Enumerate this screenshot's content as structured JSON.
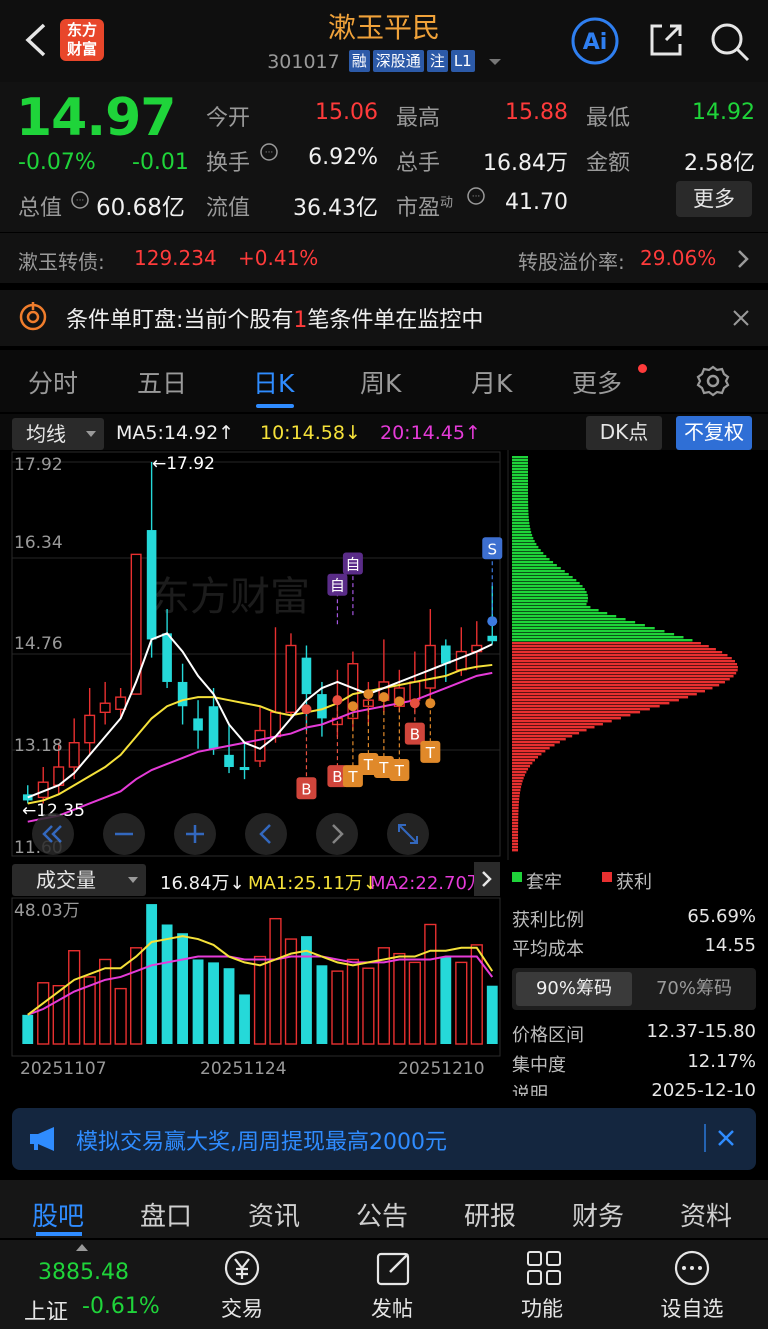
{
  "header": {
    "title": "漱玉平民",
    "code": "301017",
    "tags": [
      "融",
      "深股通",
      "注",
      "L1"
    ],
    "logo_line1": "东方",
    "logo_line2": "财富",
    "ai_label": "Ai"
  },
  "quote": {
    "price": "14.97",
    "change_pct": "-0.07%",
    "change_amt": "-0.01",
    "total_value_label": "总值",
    "total_value": "60.68亿",
    "fields": [
      {
        "label": "今开",
        "value": "15.06",
        "color": "#ff3b3b"
      },
      {
        "label": "最高",
        "value": "15.88",
        "color": "#ff3b3b"
      },
      {
        "label": "最低",
        "value": "14.92",
        "color": "#1fd43a"
      },
      {
        "label": "换手",
        "value": "6.92%",
        "color": "#f0f0f0"
      },
      {
        "label": "总手",
        "value": "16.84万",
        "color": "#f0f0f0"
      },
      {
        "label": "金额",
        "value": "2.58亿",
        "color": "#f0f0f0"
      },
      {
        "label": "流值",
        "value": "36.43亿",
        "color": "#f0f0f0"
      },
      {
        "label": "市盈",
        "value": "41.70",
        "color": "#f0f0f0"
      }
    ],
    "pe_superscript": "动",
    "more_button": "更多"
  },
  "bond": {
    "name": "漱玉转债:",
    "price": "129.234",
    "change": "+0.41%",
    "premium_label": "转股溢价率:",
    "premium_value": "29.06%"
  },
  "condition": {
    "prefix": "条件单盯盘:当前个股有",
    "count": "1",
    "suffix": "笔条件单在监控中"
  },
  "tabs": [
    "分时",
    "五日",
    "日K",
    "周K",
    "月K",
    "更多"
  ],
  "active_tab": "日K",
  "chart_toolbar": {
    "ma_select": "均线",
    "ma5": "MA5:14.92↑",
    "ma10": "10:14.58↓",
    "ma20": "20:14.45↑",
    "dk_button": "DK点",
    "adjust_button": "不复权"
  },
  "volume_toolbar": {
    "select": "成交量",
    "volume": "16.84万↓",
    "ma1": "MA1:25.11万↓",
    "ma2": "MA2:22.70万"
  },
  "axis": {
    "price_ticks": [
      "17.92",
      "16.34",
      "14.76",
      "13.18",
      "11.60"
    ],
    "volume_max": "48.03万",
    "dates": [
      "20251107",
      "20251124",
      "20251210"
    ],
    "high_marker": "←17.92",
    "low_marker": "←12.35",
    "watermark": "东方财富"
  },
  "chart_data": {
    "type": "candlestick",
    "ylim": [
      11.6,
      17.92
    ],
    "candles": [
      {
        "o": 12.45,
        "c": 12.35,
        "h": 12.6,
        "l": 12.3,
        "v": 10
      },
      {
        "o": 12.4,
        "c": 12.65,
        "h": 12.9,
        "l": 12.3,
        "v": 21
      },
      {
        "o": 12.6,
        "c": 12.9,
        "h": 13.3,
        "l": 12.45,
        "v": 20
      },
      {
        "o": 12.9,
        "c": 13.3,
        "h": 13.7,
        "l": 12.7,
        "v": 32
      },
      {
        "o": 13.3,
        "c": 13.75,
        "h": 14.2,
        "l": 13.1,
        "v": 23
      },
      {
        "o": 13.8,
        "c": 13.95,
        "h": 14.3,
        "l": 13.6,
        "v": 29
      },
      {
        "o": 13.85,
        "c": 14.05,
        "h": 14.2,
        "l": 13.7,
        "v": 19
      },
      {
        "o": 14.1,
        "c": 16.4,
        "h": 16.4,
        "l": 14.1,
        "v": 33
      },
      {
        "o": 16.8,
        "c": 15.0,
        "h": 17.92,
        "l": 14.7,
        "v": 48
      },
      {
        "o": 15.1,
        "c": 14.3,
        "h": 15.5,
        "l": 14.2,
        "v": 41
      },
      {
        "o": 14.3,
        "c": 13.9,
        "h": 14.6,
        "l": 13.6,
        "v": 38
      },
      {
        "o": 13.7,
        "c": 13.5,
        "h": 14.0,
        "l": 13.2,
        "v": 29
      },
      {
        "o": 13.9,
        "c": 13.2,
        "h": 14.2,
        "l": 13.1,
        "v": 28
      },
      {
        "o": 13.1,
        "c": 12.9,
        "h": 13.6,
        "l": 12.8,
        "v": 26
      },
      {
        "o": 12.9,
        "c": 12.85,
        "h": 13.3,
        "l": 12.7,
        "v": 17
      },
      {
        "o": 13.0,
        "c": 13.5,
        "h": 13.9,
        "l": 12.9,
        "v": 30
      },
      {
        "o": 13.4,
        "c": 13.8,
        "h": 15.2,
        "l": 13.3,
        "v": 43
      },
      {
        "o": 13.8,
        "c": 14.9,
        "h": 15.1,
        "l": 13.7,
        "v": 36
      },
      {
        "o": 14.7,
        "c": 14.1,
        "h": 14.9,
        "l": 13.5,
        "v": 37
      },
      {
        "o": 14.1,
        "c": 13.7,
        "h": 14.3,
        "l": 13.4,
        "v": 27
      },
      {
        "o": 13.6,
        "c": 13.7,
        "h": 14.5,
        "l": 13.4,
        "v": 25
      },
      {
        "o": 13.7,
        "c": 14.6,
        "h": 14.8,
        "l": 13.5,
        "v": 29
      },
      {
        "o": 13.9,
        "c": 14.0,
        "h": 14.3,
        "l": 13.6,
        "v": 26
      },
      {
        "o": 14.0,
        "c": 14.3,
        "h": 15.0,
        "l": 13.8,
        "v": 33
      },
      {
        "o": 13.9,
        "c": 14.2,
        "h": 14.5,
        "l": 13.8,
        "v": 31
      },
      {
        "o": 14.0,
        "c": 14.3,
        "h": 14.8,
        "l": 13.8,
        "v": 28
      },
      {
        "o": 14.2,
        "c": 14.9,
        "h": 15.5,
        "l": 14.0,
        "v": 41
      },
      {
        "o": 14.9,
        "c": 14.6,
        "h": 15.0,
        "l": 14.3,
        "v": 30
      },
      {
        "o": 14.5,
        "c": 14.8,
        "h": 15.2,
        "l": 14.4,
        "v": 28
      },
      {
        "o": 14.8,
        "c": 14.9,
        "h": 15.3,
        "l": 14.5,
        "v": 34
      },
      {
        "o": 15.06,
        "c": 14.97,
        "h": 15.88,
        "l": 14.92,
        "v": 20
      }
    ],
    "ma5": [
      12.4,
      12.5,
      12.6,
      12.8,
      13.1,
      13.4,
      13.7,
      14.3,
      15.0,
      15.1,
      14.8,
      14.4,
      14.1,
      13.6,
      13.3,
      13.2,
      13.4,
      13.7,
      14.0,
      14.2,
      14.3,
      14.2,
      14.1,
      14.2,
      14.3,
      14.4,
      14.5,
      14.6,
      14.7,
      14.8,
      14.92
    ],
    "ma10": [
      12.3,
      12.35,
      12.45,
      12.6,
      12.75,
      12.9,
      13.1,
      13.4,
      13.7,
      13.9,
      14.0,
      14.05,
      14.05,
      14.0,
      13.95,
      13.9,
      13.8,
      13.75,
      13.8,
      13.85,
      13.95,
      14.1,
      14.15,
      14.2,
      14.25,
      14.3,
      14.35,
      14.4,
      14.5,
      14.55,
      14.58
    ],
    "ma20": [
      12.0,
      12.05,
      12.1,
      12.2,
      12.3,
      12.4,
      12.5,
      12.7,
      12.85,
      12.95,
      13.05,
      13.15,
      13.2,
      13.25,
      13.3,
      13.35,
      13.4,
      13.45,
      13.55,
      13.6,
      13.7,
      13.8,
      13.85,
      13.9,
      13.95,
      14.0,
      14.1,
      14.2,
      14.3,
      14.4,
      14.45
    ],
    "vol_ma1": [
      10,
      14,
      18,
      22,
      24,
      26,
      26,
      30,
      35,
      36,
      37,
      36,
      34,
      30,
      28,
      27,
      29,
      31,
      32,
      30,
      28,
      27,
      28,
      29,
      30,
      30,
      32,
      32,
      33,
      33,
      25
    ],
    "vol_ma2": [
      10,
      12,
      15,
      18,
      20,
      22,
      23,
      25,
      27,
      28,
      29,
      30,
      30,
      30,
      29,
      29,
      29,
      30,
      30,
      30,
      29,
      28,
      28,
      28,
      29,
      29,
      29,
      30,
      30,
      30,
      23
    ],
    "vol_max": 48.03
  },
  "chips": {
    "legend_locked": "套牢",
    "legend_profit": "获利",
    "rows": [
      {
        "label": "获利比例",
        "value": "65.69%"
      },
      {
        "label": "平均成本",
        "value": "14.55"
      }
    ],
    "tab_90": "90%筹码",
    "tab_70": "70%筹码",
    "rows2": [
      {
        "label": "价格区间",
        "value": "12.37-15.80"
      },
      {
        "label": "集中度",
        "value": "12.17%"
      },
      {
        "label": "说明",
        "value": "2025-12-10"
      }
    ]
  },
  "signals": {
    "buy": "B",
    "sell": "S",
    "t": "T",
    "self": "自"
  },
  "banner": {
    "text": "模拟交易赢大奖,周周提现最高2000元"
  },
  "bottom_tabs": [
    "股吧",
    "盘口",
    "资讯",
    "公告",
    "研报",
    "财务",
    "资料"
  ],
  "dock": {
    "index_value": "3885.48",
    "index_name": "上证",
    "index_change": "-0.61%",
    "items": [
      "交易",
      "发帖",
      "功能",
      "设自选"
    ]
  }
}
